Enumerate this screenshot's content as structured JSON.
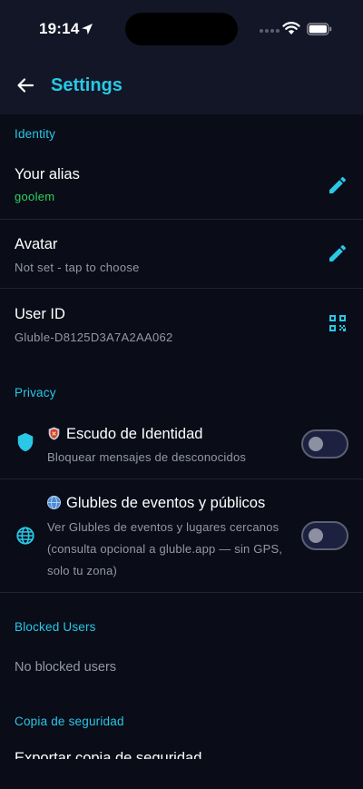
{
  "status_bar": {
    "time": "19:14"
  },
  "appbar": {
    "title": "Settings"
  },
  "sections": {
    "identity": "Identity",
    "privacy": "Privacy",
    "blocked": "Blocked Users",
    "backup": "Copia de seguridad"
  },
  "identity": {
    "alias": {
      "label": "Your alias",
      "value": "goolem"
    },
    "avatar": {
      "label": "Avatar",
      "value": "Not set - tap to choose"
    },
    "user_id": {
      "label": "User ID",
      "value": "Gluble-D8125D3A7A2AA062"
    }
  },
  "privacy": {
    "shield": {
      "title": "Escudo de Identidad",
      "subtitle": "Bloquear mensajes de desconocidos",
      "enabled": false
    },
    "public": {
      "title": "Glubles de eventos y públicos",
      "subtitle": "Ver Glubles de eventos y lugares cercanos (consulta opcional a gluble.app — sin GPS, solo tu zona)",
      "enabled": false
    }
  },
  "blocked": {
    "empty_text": "No blocked users"
  },
  "backup": {
    "partial_item": "Exportar copia de seguridad"
  },
  "colors": {
    "accent": "#28c8e6",
    "background": "#0a0c18",
    "bar": "#121626",
    "alias_green": "#2fd35a",
    "muted": "#9498a6"
  }
}
